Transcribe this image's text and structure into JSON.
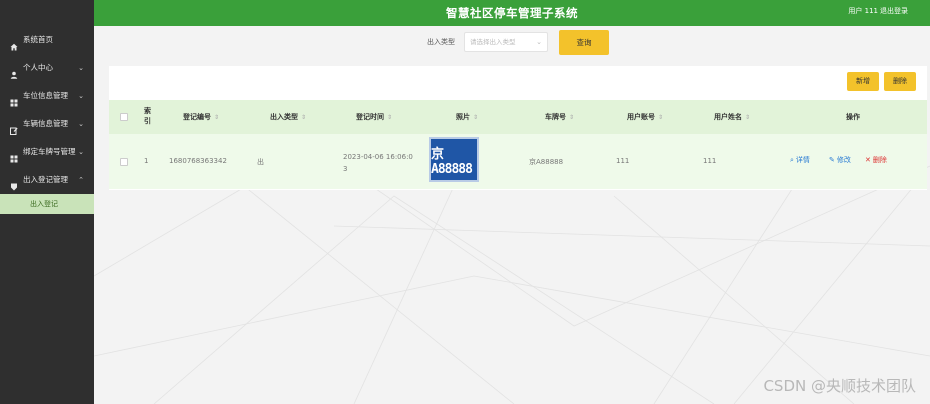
{
  "header": {
    "title": "智慧社区停车管理子系统",
    "user": "用户 111",
    "logout": "退出登录"
  },
  "sidebar": {
    "items": [
      {
        "label": "系统首页",
        "icon": "home-icon",
        "chevron": ""
      },
      {
        "label": "个人中心",
        "icon": "user-icon",
        "chevron": "⌄"
      },
      {
        "label": "车位信息管理",
        "icon": "grid-icon",
        "chevron": "⌄"
      },
      {
        "label": "车辆信息管理",
        "icon": "edit-icon",
        "chevron": "⌄"
      },
      {
        "label": "绑定车牌号管理",
        "icon": "grid-icon",
        "chevron": "⌄"
      },
      {
        "label": "出入登记管理",
        "icon": "pin-icon",
        "chevron": "⌃"
      }
    ],
    "sub_item": "出入登记"
  },
  "search": {
    "label": "出入类型",
    "placeholder": "请选择出入类型",
    "query_button": "查询"
  },
  "toolbar": {
    "add": "新增",
    "delete": "删除"
  },
  "table": {
    "headers": {
      "index": "索引",
      "reg_no": "登记编号",
      "type": "出入类型",
      "time": "登记时间",
      "photo": "照片",
      "plate": "车牌号",
      "account": "用户账号",
      "name": "用户姓名",
      "ops": "操作"
    },
    "rows": [
      {
        "index": "1",
        "reg_no": "1680768363342",
        "type": "出",
        "time_line1": "2023-04-06 16:06:0",
        "time_line2": "3",
        "photo_text": "京A88888",
        "plate": "京A88888",
        "account": "111",
        "name": "111",
        "detail": "详情",
        "edit": "修改",
        "delete": "删除"
      }
    ]
  },
  "watermark": "CSDN @央顺技术团队",
  "colors": {
    "header_green": "#3aa03a",
    "sidebar_dark": "#2f2f2f",
    "accent_yellow": "#f3c22b",
    "row_green": "#effaea",
    "plate_blue": "#1f56a6"
  }
}
